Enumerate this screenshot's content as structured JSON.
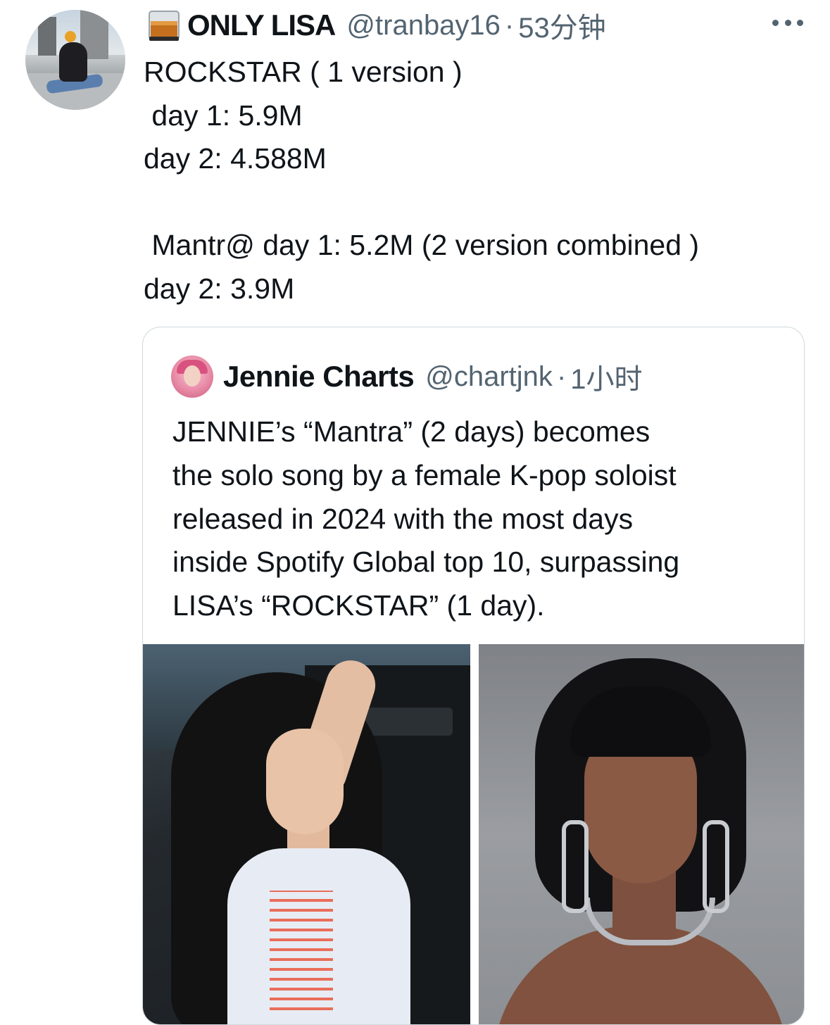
{
  "tweet": {
    "author_name": "ONLY LISA",
    "author_handle": "@tranbay16",
    "separator": "·",
    "time": "53分钟",
    "author_emoji_icon": "whisky-glass-icon",
    "text_lines": [
      "ROCKSTAR ( 1 version )",
      " day 1: 5.9M",
      "day 2: 4.588M",
      "",
      " Mantr@ day 1: 5.2M (2 version combined )",
      "day 2: 3.9M"
    ]
  },
  "quoted_tweet": {
    "author_name": "Jennie Charts",
    "author_handle": "@chartjnk",
    "separator": "·",
    "time": "1小时",
    "text_lines": [
      "JENNIE’s “Mantra” (2 days) becomes",
      "the solo song by a female K-pop soloist",
      "released in 2024 with the most days",
      "inside Spotify Global top 10, surpassing",
      "LISA’s “ROCKSTAR” (1 day)."
    ]
  },
  "colors": {
    "text": "#0f1419",
    "secondary": "#536471",
    "border": "#cfd9de"
  }
}
